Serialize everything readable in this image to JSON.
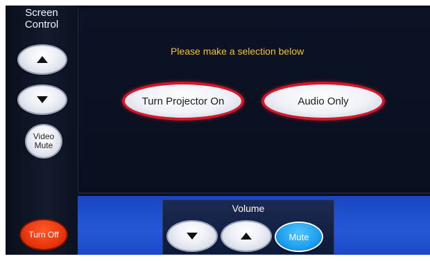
{
  "sidebar": {
    "title_line1": "Screen",
    "title_line2": "Control",
    "video_mute_line1": "Video",
    "video_mute_line2": "Mute",
    "turn_off_label": "Turn Off"
  },
  "main": {
    "prompt": "Please make a selection below",
    "option_projector": "Turn Projector On",
    "option_audio": "Audio Only"
  },
  "volume": {
    "label": "Volume",
    "mute_label": "Mute"
  },
  "colors": {
    "prompt": "#f1c22b",
    "selection_outline": "#d4172a",
    "turn_off": "#e8360c",
    "mute": "#1da0f0",
    "bottom_strip": "#2558d6"
  },
  "icons": [
    "up-arrow-icon",
    "down-arrow-icon"
  ]
}
